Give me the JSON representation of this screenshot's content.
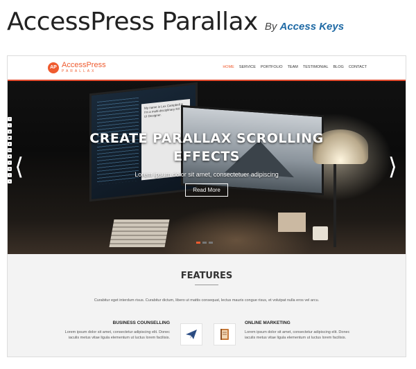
{
  "heading": {
    "title": "AccessPress Parallax",
    "by": "By",
    "author": "Access Keys"
  },
  "site": {
    "logo_badge": "AP",
    "logo_name": "AccessPress",
    "logo_sub": "PARALLAX",
    "nav": [
      "HOME",
      "SERVICE",
      "PORTFOLIO",
      "TEAM",
      "TESTIMONIAL",
      "BLOG",
      "CONTACT"
    ],
    "active_nav": "HOME",
    "accent_color": "#ef5b2f"
  },
  "hero": {
    "title_line1": "CREATE PARALLAX SCROLLING",
    "title_line2": "EFFECTS",
    "subtitle": "Lorem ipsum dolor sit amet, consectetuer adipiscing",
    "button": "Read More",
    "screen_text": "My name is Lux Campbell & I'm a multi-disciplinary RX & UI Designer.",
    "social_icons": [
      "facebook-icon",
      "twitter-icon",
      "google-plus-icon",
      "youtube-icon",
      "pinterest-icon",
      "linkedin-icon",
      "flickr-icon",
      "vimeo-icon",
      "instagram-icon",
      "tumblr-icon",
      "skype-icon"
    ],
    "slide_count": 3,
    "active_slide": 1
  },
  "features": {
    "title": "FEATURES",
    "description": "Curabitur eget interdum risus. Curabitur dictum, libero ut mattis consequat, lectus mauris congue risus, et volutpat nulla eros vel arcu.",
    "items": [
      {
        "heading": "BUSINESS COUNSELLING",
        "text1": "Lorem ipsum dolor sit amet, consectetur adipiscing elit. Donec",
        "text2": "iaculis metus vitae ligula elementum ut luctus lorem facilisis.",
        "icon": "paper-plane-icon"
      },
      {
        "heading": "ONLINE MARKETING",
        "text1": "Lorem ipsum dolor sit amet, consectetur adipiscing elit. Donec",
        "text2": "iaculis metus vitae ligula elementum ut luctus lorem facilisis.",
        "icon": "notebook-icon"
      }
    ]
  }
}
